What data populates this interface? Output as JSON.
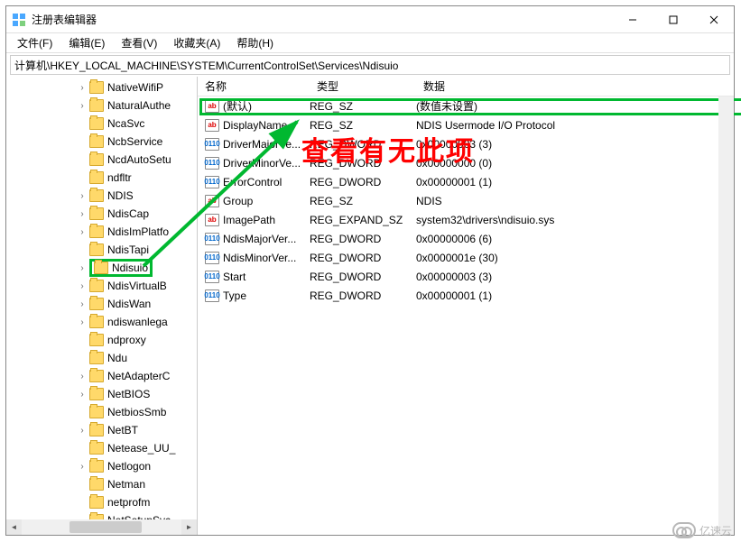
{
  "window": {
    "title": "注册表编辑器"
  },
  "menus": [
    "文件(F)",
    "编辑(E)",
    "查看(V)",
    "收藏夹(A)",
    "帮助(H)"
  ],
  "address": "计算机\\HKEY_LOCAL_MACHINE\\SYSTEM\\CurrentControlSet\\Services\\Ndisuio",
  "tree": [
    {
      "label": "NativeWifiP",
      "exp": "›"
    },
    {
      "label": "NaturalAuthe",
      "exp": "›"
    },
    {
      "label": "NcaSvc",
      "exp": ""
    },
    {
      "label": "NcbService",
      "exp": ""
    },
    {
      "label": "NcdAutoSetu",
      "exp": ""
    },
    {
      "label": "ndfltr",
      "exp": ""
    },
    {
      "label": "NDIS",
      "exp": "›"
    },
    {
      "label": "NdisCap",
      "exp": "›"
    },
    {
      "label": "NdisImPlatfo",
      "exp": "›"
    },
    {
      "label": "NdisTapi",
      "exp": ""
    },
    {
      "label": "Ndisuio",
      "exp": "›",
      "selected": true
    },
    {
      "label": "NdisVirtualB",
      "exp": "›"
    },
    {
      "label": "NdisWan",
      "exp": "›"
    },
    {
      "label": "ndiswanlega",
      "exp": "›"
    },
    {
      "label": "ndproxy",
      "exp": ""
    },
    {
      "label": "Ndu",
      "exp": ""
    },
    {
      "label": "NetAdapterC",
      "exp": "›"
    },
    {
      "label": "NetBIOS",
      "exp": "›"
    },
    {
      "label": "NetbiosSmb",
      "exp": ""
    },
    {
      "label": "NetBT",
      "exp": "›"
    },
    {
      "label": "Netease_UU_",
      "exp": ""
    },
    {
      "label": "Netlogon",
      "exp": "›"
    },
    {
      "label": "Netman",
      "exp": ""
    },
    {
      "label": "netprofm",
      "exp": ""
    },
    {
      "label": "NetSetupSvc",
      "exp": ""
    }
  ],
  "columns": {
    "name": "名称",
    "type": "类型",
    "data": "数据"
  },
  "values": [
    {
      "icon": "sz",
      "name": "(默认)",
      "type": "REG_SZ",
      "data": "(数值未设置)"
    },
    {
      "icon": "sz",
      "name": "DisplayName",
      "type": "REG_SZ",
      "data": "NDIS Usermode I/O Protocol",
      "highlight": true
    },
    {
      "icon": "dw",
      "name": "DriverMajorVe...",
      "type": "REG_DWORD",
      "data": "0x00000003 (3)"
    },
    {
      "icon": "dw",
      "name": "DriverMinorVe...",
      "type": "REG_DWORD",
      "data": "0x00000000 (0)"
    },
    {
      "icon": "dw",
      "name": "ErrorControl",
      "type": "REG_DWORD",
      "data": "0x00000001 (1)"
    },
    {
      "icon": "sz",
      "name": "Group",
      "type": "REG_SZ",
      "data": "NDIS"
    },
    {
      "icon": "sz",
      "name": "ImagePath",
      "type": "REG_EXPAND_SZ",
      "data": "system32\\drivers\\ndisuio.sys"
    },
    {
      "icon": "dw",
      "name": "NdisMajorVer...",
      "type": "REG_DWORD",
      "data": "0x00000006 (6)"
    },
    {
      "icon": "dw",
      "name": "NdisMinorVer...",
      "type": "REG_DWORD",
      "data": "0x0000001e (30)"
    },
    {
      "icon": "dw",
      "name": "Start",
      "type": "REG_DWORD",
      "data": "0x00000003 (3)"
    },
    {
      "icon": "dw",
      "name": "Type",
      "type": "REG_DWORD",
      "data": "0x00000001 (1)"
    }
  ],
  "annotation": "查看有无此项",
  "watermark": "亿速云"
}
